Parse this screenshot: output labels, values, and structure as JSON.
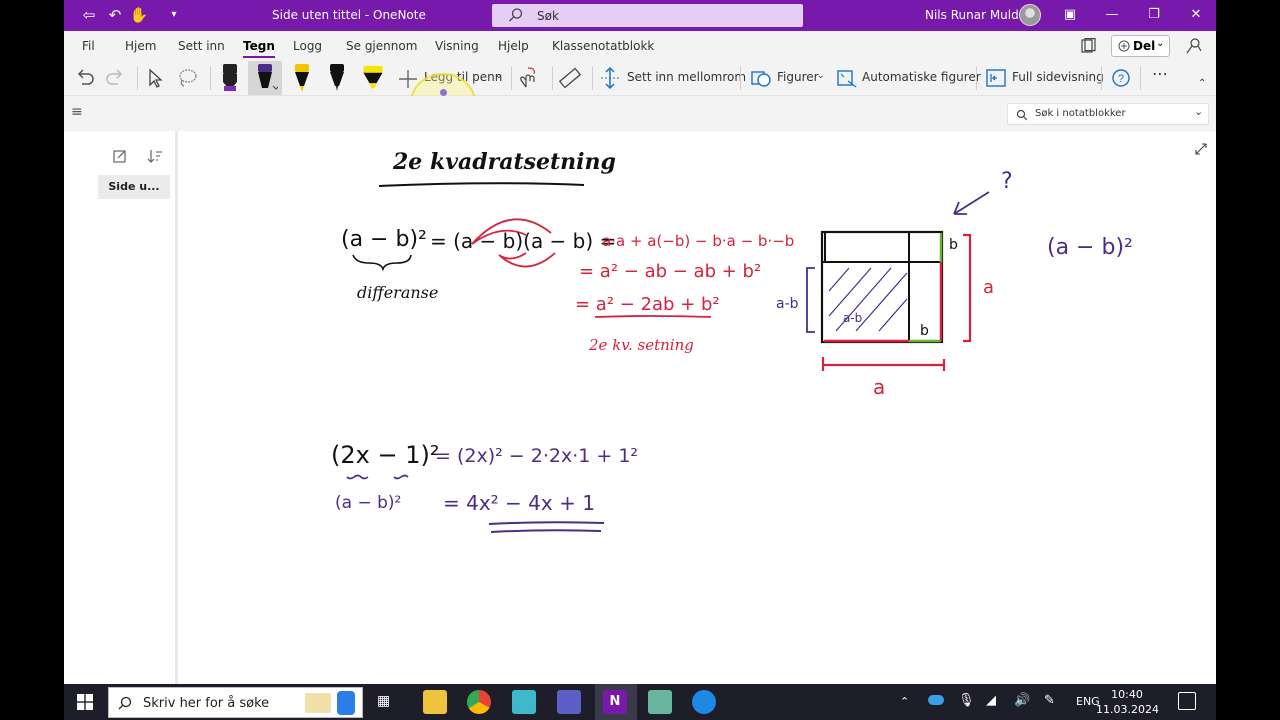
{
  "titlebar": {
    "title": "Side uten tittel  -  OneNote",
    "search_placeholder": "Søk",
    "user_name": "Nils Runar Mulder"
  },
  "menu": {
    "items": [
      "Fil",
      "Hjem",
      "Sett inn",
      "Tegn",
      "Logg",
      "Se gjennom",
      "Visning",
      "Hjelp",
      "Klassenotatblokk"
    ],
    "active": "Tegn",
    "share_label": "Del"
  },
  "ribbon": {
    "add_pen": "Legg til penn",
    "insert_space": "Sett inn mellomrom",
    "shapes": "Figurer",
    "auto_shapes": "Automatiske figurer",
    "full_view": "Full sidevisning"
  },
  "nav": {
    "search_notebooks": "Søk i notatblokker"
  },
  "pages": {
    "items": [
      "Side u..."
    ]
  },
  "notes": {
    "heading": "2e kvadratsetning",
    "differanse": "differanse",
    "line1_left": "(a − b)²",
    "line1_eq": "= (a − b)(a − b) =",
    "expand1": "a·a + a(−b) − b·a − b·−b",
    "expand2": "= a² − ab − ab + b²",
    "expand3": "= a² − 2ab + b²",
    "rule_name": "2e kv. setning",
    "question": "?",
    "label_a_side": "a",
    "label_a_bottom": "a",
    "label_b_top": "b",
    "label_b_bottom": "b",
    "label_amb_left": "a-b",
    "label_amb_inner": "a-b",
    "side_expr": "(a − b)²",
    "ex_left": "(2x − 1)²",
    "ex_mid": "= (2x)² − 2·2x·1 + 1²",
    "ex_pattern": "(a − b)²",
    "ex_result": "= 4x² − 4x + 1"
  },
  "taskbar": {
    "search_placeholder": "Skriv her for å søke",
    "language": "ENG",
    "time": "10:40",
    "date": "11.03.2024"
  },
  "colors": {
    "onenote_purple": "#7719aa",
    "ink_black": "#111111",
    "ink_red": "#d6223e",
    "ink_purple": "#4b2d86",
    "ink_green": "#5fb82b"
  }
}
